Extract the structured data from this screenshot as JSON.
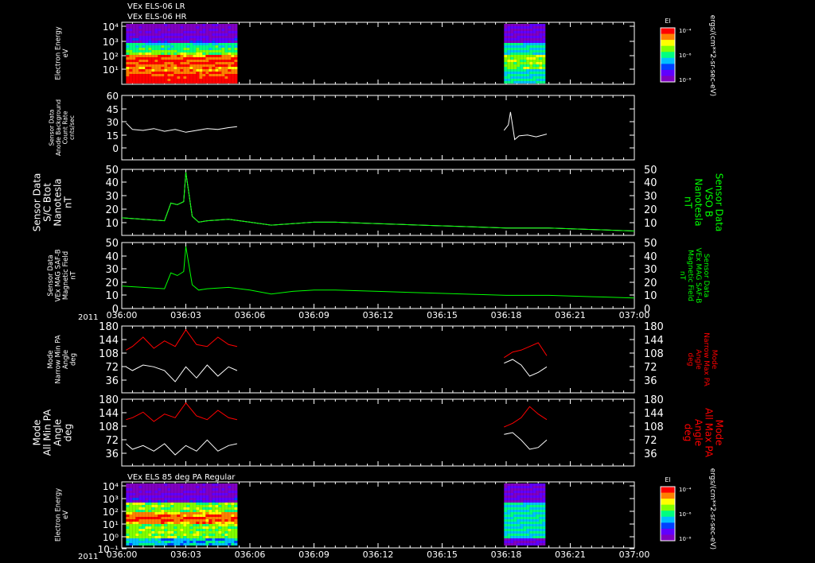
{
  "header": {
    "title_line1": "VEx ELS-06 LR",
    "title_line2": "VEx ELS-06 HR",
    "title_bottom": "VEx ELS 85 deg PA Regular",
    "year": "2011"
  },
  "x_axis": {
    "ticks": [
      "036:00",
      "036:03",
      "036:06",
      "036:09",
      "036:12",
      "036:15",
      "036:18",
      "036:21",
      "037:00"
    ],
    "tick_minutes": [
      0,
      3,
      6,
      9,
      12,
      15,
      18,
      21,
      24
    ]
  },
  "colorbar": {
    "title": "El",
    "units": "ergs/(cm**2-sr-sec-eV)",
    "tick_labels": [
      "10⁻⁴",
      "10⁻⁶",
      "10⁻⁸"
    ],
    "colors": [
      "#ff0000",
      "#ff8000",
      "#ffff00",
      "#80ff00",
      "#00ff80",
      "#00c0ff",
      "#0040ff",
      "#6000ff",
      "#8000c0"
    ]
  },
  "panels": {
    "p1": {
      "ylabel": [
        "Electron Energy",
        "eV"
      ],
      "yticks": [
        "10⁴",
        "10³",
        "10²",
        "10¹"
      ]
    },
    "p2": {
      "ylabel": [
        "Sensor Data",
        "Anode Background",
        "Count Rate",
        "cnts/sec"
      ],
      "yticks": [
        "60",
        "45",
        "30",
        "15",
        "0"
      ]
    },
    "p3": {
      "ylabel": [
        "Sensor Data",
        "S/C Btot",
        "Nanotesla",
        "nT"
      ],
      "right_label": [
        "Sensor Data",
        "VSO B",
        "Nanotesla",
        "nT"
      ],
      "yticks": [
        "50",
        "40",
        "30",
        "20",
        "10"
      ],
      "right_color": "#00ff00"
    },
    "p4": {
      "ylabel": [
        "Sensor Data",
        "VEx MAG SAF-B",
        "Magnetic Field",
        "nT"
      ],
      "right_label": [
        "Sensor Data",
        "VEx MAG SAF-B",
        "Magnetic Field",
        "nT"
      ],
      "yticks": [
        "50",
        "40",
        "30",
        "20",
        "10",
        "0"
      ],
      "right_color": "#00ff00"
    },
    "p5": {
      "ylabel": [
        "Mode",
        "Narrow Min PA",
        "Angle",
        "deg"
      ],
      "right_label": [
        "Mode",
        "Narrow Max PA",
        "Angle",
        "deg"
      ],
      "yticks": [
        "180",
        "144",
        "108",
        "72",
        "36"
      ],
      "right_color": "#ff0000"
    },
    "p6": {
      "ylabel": [
        "Mode",
        "All Min PA",
        "Angle",
        "deg"
      ],
      "right_label": [
        "Mode",
        "All Max PA",
        "Angle",
        "deg"
      ],
      "yticks": [
        "180",
        "144",
        "108",
        "72",
        "36"
      ],
      "right_color": "#ff0000"
    },
    "p7": {
      "ylabel": [
        "Electron Energy",
        "eV"
      ],
      "yticks": [
        "10⁴",
        "10³",
        "10²",
        "10¹",
        "10⁰",
        "10⁻¹"
      ]
    }
  },
  "chart_data": [
    {
      "type": "heatmap",
      "title": "VEx ELS-06 LR / VEx ELS-06 HR",
      "ylabel": "Electron Energy eV",
      "ylim": [
        1,
        10000
      ],
      "y_scale": "log",
      "xlim_minutes": [
        0,
        24
      ],
      "segments_minutes": [
        [
          0.2,
          5.4
        ],
        [
          17.9,
          19.9
        ]
      ]
    },
    {
      "type": "line",
      "ylabel": "Anode Background Count Rate cnts/sec",
      "ylim": [
        -10,
        60
      ],
      "series": [
        {
          "color": "#ffffff",
          "segments": [
            {
              "x": [
                0.2,
                0.5,
                1.0,
                1.5,
                2.0,
                2.5,
                3.0,
                3.5,
                4.0,
                4.5,
                5.0,
                5.4
              ],
              "y": [
                30,
                23,
                22,
                24,
                21,
                23,
                20,
                22,
                24,
                23,
                25,
                26
              ]
            },
            {
              "x": [
                17.9,
                18.1,
                18.2,
                18.4,
                18.6,
                19.0,
                19.4,
                19.9
              ],
              "y": [
                22,
                28,
                42,
                12,
                16,
                17,
                15,
                18
              ]
            }
          ]
        }
      ]
    },
    {
      "type": "line",
      "ylabel": "S/C Btot Nanotesla nT",
      "ylim": [
        5,
        50
      ],
      "series": [
        {
          "color": "#ffffff",
          "x": [
            0,
            1,
            2,
            2.3,
            2.6,
            2.9,
            3.0,
            3.3,
            3.6,
            4,
            5,
            6,
            7,
            8,
            9,
            10,
            12,
            14,
            16,
            18,
            20,
            22,
            24
          ],
          "y": [
            17,
            16,
            15,
            27,
            26,
            28,
            48,
            18,
            14,
            15,
            16,
            14,
            12,
            13,
            14,
            14,
            13,
            12,
            11,
            10,
            10,
            9,
            8
          ]
        },
        {
          "color": "#00ff00",
          "x": [
            0,
            1,
            2,
            2.3,
            2.6,
            2.9,
            3.0,
            3.3,
            3.6,
            4,
            5,
            6,
            7,
            8,
            9,
            10,
            12,
            14,
            16,
            18,
            20,
            22,
            24
          ],
          "y": [
            17,
            16,
            15,
            27,
            26,
            28,
            48,
            18,
            14,
            15,
            16,
            14,
            12,
            13,
            14,
            14,
            13,
            12,
            11,
            10,
            10,
            9,
            8
          ]
        }
      ]
    },
    {
      "type": "line",
      "ylabel": "VEx MAG SAF-B Magnetic Field nT",
      "ylim": [
        0,
        50
      ],
      "series": [
        {
          "color": "#00ff00",
          "x": [
            0,
            1,
            2,
            2.3,
            2.6,
            2.9,
            3.0,
            3.3,
            3.6,
            4,
            5,
            6,
            7,
            8,
            9,
            10,
            12,
            14,
            16,
            18,
            20,
            22,
            24
          ],
          "y": [
            17,
            16,
            15,
            27,
            25,
            28,
            47,
            18,
            14,
            15,
            16,
            14,
            11,
            13,
            14,
            14,
            13,
            12,
            11,
            10,
            10,
            9,
            8
          ]
        }
      ]
    },
    {
      "type": "line",
      "ylabel": "Narrow Min/Max PA Angle deg",
      "ylim": [
        0,
        180
      ],
      "series": [
        {
          "name": "Max PA",
          "color": "#ff0000",
          "segments": [
            {
              "x": [
                0.2,
                0.5,
                1.0,
                1.5,
                2.0,
                2.5,
                3.0,
                3.5,
                4.0,
                4.5,
                5.0,
                5.4
              ],
              "y": [
                115,
                125,
                150,
                120,
                140,
                125,
                170,
                130,
                125,
                150,
                130,
                125
              ]
            },
            {
              "x": [
                17.9,
                18.3,
                18.7,
                19.1,
                19.5,
                19.9
              ],
              "y": [
                95,
                110,
                115,
                125,
                135,
                100
              ]
            }
          ]
        },
        {
          "name": "Min PA",
          "color": "#ffffff",
          "segments": [
            {
              "x": [
                0.2,
                0.5,
                1.0,
                1.5,
                2.0,
                2.5,
                3.0,
                3.5,
                4.0,
                4.5,
                5.0,
                5.4
              ],
              "y": [
                70,
                60,
                75,
                70,
                60,
                30,
                70,
                40,
                75,
                45,
                70,
                60
              ]
            },
            {
              "x": [
                17.9,
                18.3,
                18.7,
                19.1,
                19.5,
                19.9
              ],
              "y": [
                80,
                90,
                75,
                45,
                55,
                70
              ]
            }
          ]
        }
      ]
    },
    {
      "type": "line",
      "ylabel": "All Min/Max PA Angle deg",
      "ylim": [
        0,
        180
      ],
      "series": [
        {
          "name": "Max PA",
          "color": "#ff0000",
          "segments": [
            {
              "x": [
                0.2,
                0.5,
                1.0,
                1.5,
                2.0,
                2.5,
                3.0,
                3.5,
                4.0,
                4.5,
                5.0,
                5.4
              ],
              "y": [
                125,
                130,
                145,
                120,
                140,
                130,
                170,
                135,
                125,
                150,
                130,
                125
              ]
            },
            {
              "x": [
                17.9,
                18.3,
                18.7,
                19.1,
                19.5,
                19.9
              ],
              "y": [
                105,
                115,
                130,
                160,
                140,
                125
              ]
            }
          ]
        },
        {
          "name": "Min PA",
          "color": "#ffffff",
          "segments": [
            {
              "x": [
                0.2,
                0.5,
                1.0,
                1.5,
                2.0,
                2.5,
                3.0,
                3.5,
                4.0,
                4.5,
                5.0,
                5.4
              ],
              "y": [
                60,
                45,
                55,
                40,
                60,
                30,
                55,
                40,
                70,
                40,
                55,
                60
              ]
            },
            {
              "x": [
                17.9,
                18.3,
                18.7,
                19.1,
                19.5,
                19.9
              ],
              "y": [
                85,
                90,
                70,
                45,
                50,
                70
              ]
            }
          ]
        }
      ]
    },
    {
      "type": "heatmap",
      "title": "VEx ELS 85 deg PA Regular",
      "ylabel": "Electron Energy eV",
      "ylim": [
        0.1,
        10000
      ],
      "y_scale": "log",
      "xlim_minutes": [
        0,
        24
      ],
      "segments_minutes": [
        [
          0.2,
          5.4
        ],
        [
          17.9,
          19.9
        ]
      ]
    }
  ]
}
